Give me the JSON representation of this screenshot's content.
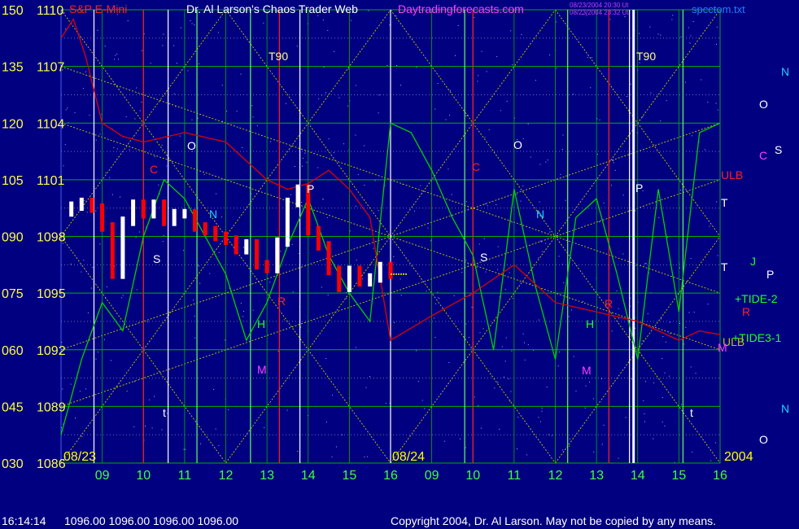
{
  "header": {
    "symbol_title": "S&P E-Mini",
    "main_title": "Dr. Al Larson's Chaos Trader Web",
    "website": "Daytradingforecasts.com",
    "stamp_line1": "08/23/2004 20:30 Ut",
    "stamp_line2": "08/23/2004 23:32 Ut",
    "filename": "spcctom.txt"
  },
  "footer": {
    "time": "16:14:14",
    "ohlc": "1096.00 1096.00 1096.00 1096.00",
    "copyright": "Copyright 2004, Dr. Al Larson. May not be copied by any means."
  },
  "chart_data": {
    "type": "line",
    "title": "S&P E-Mini",
    "y_axis_left_outer": {
      "labels": [
        "150",
        "135",
        "120",
        "105",
        "090",
        "075",
        "060",
        "045",
        "030"
      ]
    },
    "y_axis_left_inner": {
      "labels": [
        "1110",
        "1107",
        "1104",
        "1101",
        "1098",
        "1095",
        "1092",
        "1089",
        "1086"
      ],
      "range": [
        1086,
        1110
      ],
      "step": 3
    },
    "x_axis": {
      "hour_labels": [
        "09",
        "10",
        "11",
        "12",
        "13",
        "14",
        "15",
        "16",
        "09",
        "10",
        "11",
        "12",
        "13",
        "14",
        "15",
        "16"
      ],
      "date_labels": [
        "08/23",
        "08/24"
      ],
      "year_label": "2004"
    },
    "price_bars_0823": {
      "x_hours": [
        8.0,
        8.25,
        8.5,
        8.75,
        9.0,
        9.25,
        9.5,
        9.75,
        10.0,
        10.25,
        10.5,
        10.75,
        11.0,
        11.25,
        11.5,
        11.75,
        12.0,
        12.25,
        12.5,
        12.75,
        13.0,
        13.25,
        13.5,
        13.75,
        14.0,
        14.25,
        14.5,
        14.75,
        15.0,
        15.25,
        15.5,
        15.75,
        16.0
      ],
      "close": [
        1099.3,
        1099.6,
        1099.8,
        1099.5,
        1098.5,
        1096.0,
        1098.8,
        1099.7,
        1099.2,
        1099.7,
        1098.8,
        1099.2,
        1099.2,
        1098.5,
        1098.3,
        1098.0,
        1097.8,
        1097.3,
        1097.6,
        1096.5,
        1096.3,
        1097.7,
        1099.8,
        1100.5,
        1098.3,
        1097.5,
        1096.2,
        1095.3,
        1096.2,
        1095.6,
        1095.8,
        1096.4,
        1096.0
      ]
    },
    "tracer_flux_green": {
      "x_hours": [
        8.0,
        8.5,
        9.0,
        9.5,
        10.0,
        10.5,
        11.0,
        11.5,
        12.0,
        12.5,
        13.0,
        13.5,
        14.0,
        14.5,
        15.0,
        15.5,
        16.0,
        16.5,
        17.0,
        17.5,
        18.0,
        18.5,
        19.0,
        19.5,
        20.0,
        20.5,
        21.0,
        21.5,
        22.0,
        22.5,
        23.0,
        23.5,
        24.0
      ],
      "y": [
        1087.5,
        1091.5,
        1094.5,
        1093.0,
        1098.0,
        1101.0,
        1100.0,
        1098.0,
        1096.0,
        1092.5,
        1094.5,
        1097.5,
        1100.0,
        1097.0,
        1095.0,
        1093.5,
        1104.0,
        1103.5,
        1101.5,
        1099.0,
        1097.0,
        1092.0,
        1100.5,
        1095.5,
        1091.5,
        1099.0,
        1100.0,
        1096.0,
        1091.5,
        1100.5,
        1094.0,
        1103.5,
        1104.0
      ]
    },
    "tracer_flux_red": {
      "x_hours": [
        8.0,
        8.3,
        8.6,
        9.0,
        9.5,
        10.0,
        11.0,
        12.0,
        13.0,
        13.5,
        14.0,
        14.5,
        15.0,
        15.5,
        16.0,
        17.0,
        18.0,
        19.0,
        20.0,
        21.0,
        22.0,
        23.0,
        23.5,
        24.0
      ],
      "y": [
        1108.5,
        1109.5,
        1107.5,
        1104.0,
        1103.3,
        1103.0,
        1103.5,
        1103.0,
        1101.0,
        1100.5,
        1100.8,
        1101.5,
        1100.5,
        1099.0,
        1092.5,
        1093.8,
        1095.0,
        1096.5,
        1094.5,
        1094.0,
        1093.5,
        1092.5,
        1093.0,
        1092.8
      ]
    },
    "sidebar_labels": [
      {
        "text": "N"
      },
      {
        "text": "O"
      },
      {
        "text": "C"
      },
      {
        "text": "S"
      },
      {
        "text": "ULB"
      },
      {
        "text": "T"
      },
      {
        "text": "T"
      },
      {
        "text": "J"
      },
      {
        "text": "P"
      },
      {
        "text": "+TIDE-2"
      },
      {
        "text": "R"
      },
      {
        "text": "+TIDE3-1"
      },
      {
        "text": "ULB"
      },
      {
        "text": "M"
      },
      {
        "text": "N"
      },
      {
        "text": "O"
      }
    ],
    "line_markers": [
      {
        "text": "T90"
      },
      {
        "text": "T90"
      },
      {
        "text": "C"
      },
      {
        "text": "C"
      },
      {
        "text": "O"
      },
      {
        "text": "O"
      },
      {
        "text": "S"
      },
      {
        "text": "S"
      },
      {
        "text": "N"
      },
      {
        "text": "N"
      },
      {
        "text": "P"
      },
      {
        "text": "P"
      },
      {
        "text": "H"
      },
      {
        "text": "H"
      },
      {
        "text": "M"
      },
      {
        "text": "M"
      },
      {
        "text": "R"
      },
      {
        "text": "R"
      },
      {
        "text": "t"
      },
      {
        "text": "t"
      }
    ],
    "grid": true,
    "colors": {
      "background": "#000080",
      "header_red": "#ff2020",
      "header_white": "#ffffff",
      "website_magenta": "#ff40ff",
      "axis_yellow": "#ffff40",
      "hour_green": "#40ff40",
      "date_yellow": "#ffff00",
      "grid_yellow": "#c8c800",
      "grid_green": "#00b000",
      "vline_white": "#ffffff",
      "vline_red": "#ff2020",
      "flux_green": "#00d000",
      "flux_red": "#e00000",
      "price_white": "#ffffff",
      "price_red": "#ff0000",
      "label_cyan": "#20d0ff"
    }
  }
}
